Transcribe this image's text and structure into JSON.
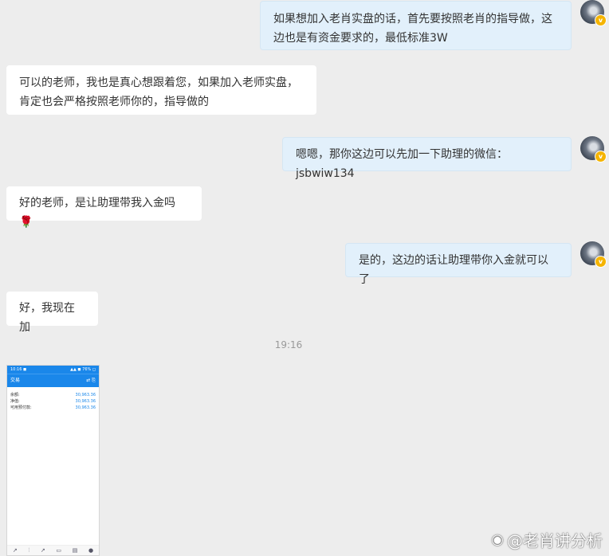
{
  "messages": [
    {
      "text": "如果想加入老肖实盘的话，首先要按照老肖的指导做，这边也是有资金要求的，最低标准3W"
    },
    {
      "text": "可以的老师，我也是真心想跟着您，如果加入老师实盘，肯定也会严格按照老师你的，指导做的"
    },
    {
      "text": "嗯嗯，那你这边可以先加一下助理的微信：jsbwiw134"
    },
    {
      "text": "好的老师，是让助理带我入金吗🌹"
    },
    {
      "text": "是的，这边的话让助理带你入金就可以了"
    },
    {
      "text": "好，我现在加"
    }
  ],
  "timestamp": "19:16",
  "screenshot": {
    "status_left": "10:16 ◼",
    "status_right": "▲▲ ◼ 76% ◻",
    "title": "交易",
    "title_icons": "⇄  ⎘",
    "rows": [
      {
        "label": "余额:",
        "value": "30,963.36"
      },
      {
        "label": "净值:",
        "value": "30,963.36"
      },
      {
        "label": "可用预付款:",
        "value": "30,963.36"
      }
    ],
    "footer_icons": [
      "↗",
      "⫶",
      "↗",
      "▭",
      "▤",
      "●"
    ]
  },
  "watermark": {
    "icon": "weibo-icon",
    "text": "@老肖讲分析"
  }
}
